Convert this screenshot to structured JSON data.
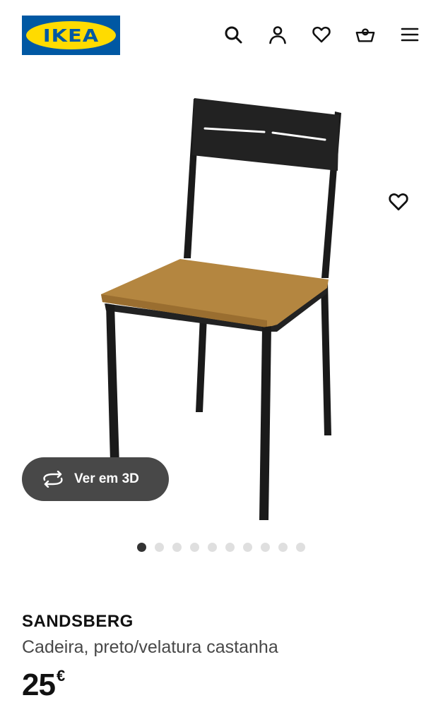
{
  "header": {
    "logo_text": "IKEA",
    "icons": [
      "search-icon",
      "user-icon",
      "heart-icon",
      "basket-icon",
      "menu-icon"
    ]
  },
  "gallery": {
    "view_3d_label": "Ver em 3D",
    "dot_count": 10,
    "active_dot": 1
  },
  "product": {
    "name": "SANDSBERG",
    "description": "Cadeira, preto/velatura castanha",
    "price": "25",
    "currency": "€"
  },
  "colors": {
    "ikea_blue": "#0058a3",
    "ikea_yellow": "#ffdb00",
    "button_bg": "#484848",
    "seat_brown": "#b48640"
  }
}
